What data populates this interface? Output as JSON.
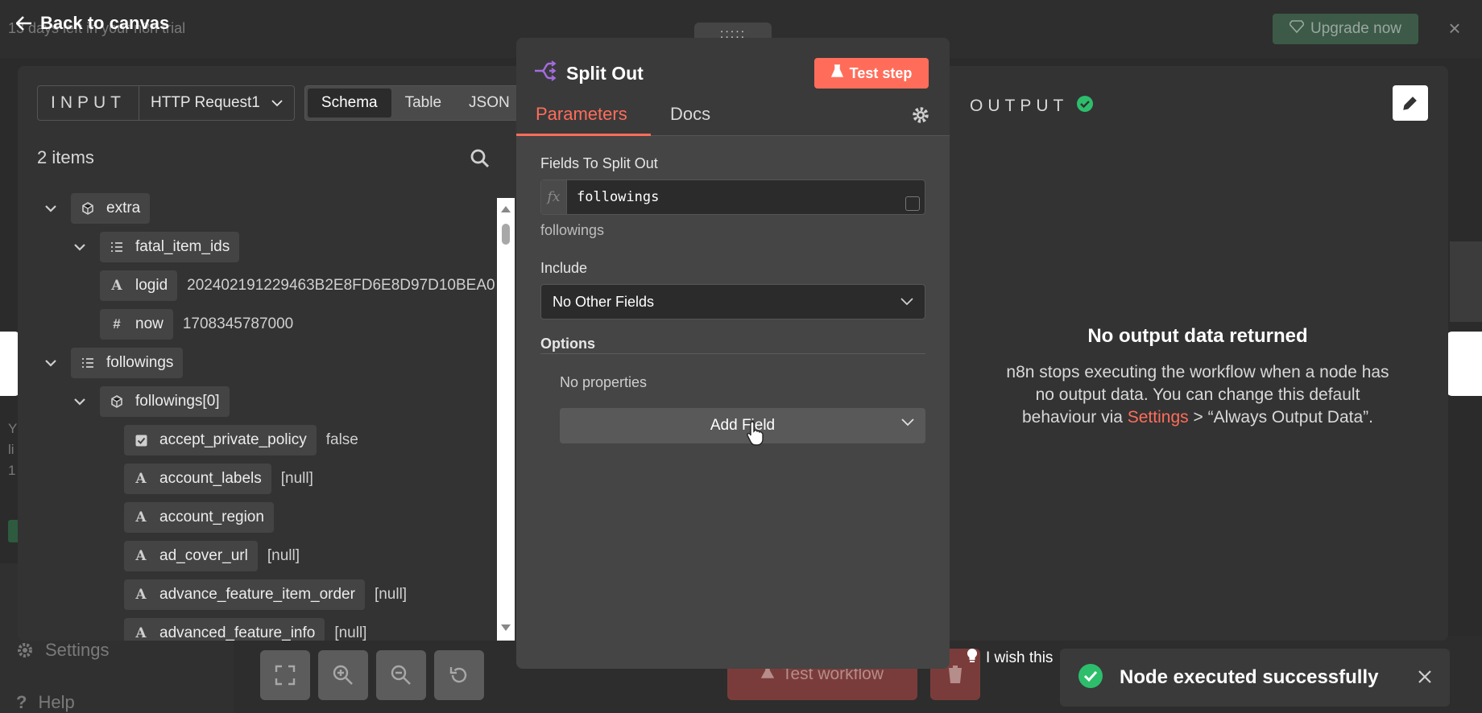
{
  "background": {
    "trial_text": "13 days left in your n8n trial",
    "upgrade_label": "Upgrade now",
    "sidebar_settings": "Settings",
    "sidebar_help": "Help",
    "test_workflow_label": "Test workflow",
    "wish_text": "I wish this"
  },
  "ndv": {
    "back_label": "Back to canvas",
    "input": {
      "label": "INPUT",
      "node_name": "HTTP Request1",
      "modes": [
        "Schema",
        "Table",
        "JSON"
      ],
      "active_mode": "Schema",
      "items_count": "2 items",
      "tree": [
        {
          "key": "extra",
          "type": "object",
          "value": "",
          "depth": 0,
          "expanded": true
        },
        {
          "key": "fatal_item_ids",
          "type": "array",
          "value": "",
          "depth": 1,
          "expanded": true
        },
        {
          "key": "logid",
          "type": "string",
          "value": "202402191229463B2E8FD6E8D97D10BEA0",
          "depth": 1
        },
        {
          "key": "now",
          "type": "number",
          "value": "1708345787000",
          "depth": 1
        },
        {
          "key": "followings",
          "type": "array",
          "value": "",
          "depth": 0,
          "expanded": true
        },
        {
          "key": "followings[0]",
          "type": "object",
          "value": "",
          "depth": 1,
          "expanded": true
        },
        {
          "key": "accept_private_policy",
          "type": "boolean",
          "value": "false",
          "depth": 2
        },
        {
          "key": "account_labels",
          "type": "string",
          "value": "[null]",
          "depth": 2
        },
        {
          "key": "account_region",
          "type": "string",
          "value": "",
          "depth": 2
        },
        {
          "key": "ad_cover_url",
          "type": "string",
          "value": "[null]",
          "depth": 2
        },
        {
          "key": "advance_feature_item_order",
          "type": "string",
          "value": "[null]",
          "depth": 2
        },
        {
          "key": "advanced_feature_info",
          "type": "string",
          "value": "[null]",
          "depth": 2
        }
      ]
    },
    "node": {
      "title": "Split Out",
      "test_step_label": "Test step",
      "tabs": [
        "Parameters",
        "Docs"
      ],
      "active_tab": "Parameters",
      "fields_label": "Fields To Split Out",
      "fields_value": "followings",
      "fields_hint": "followings",
      "include_label": "Include",
      "include_value": "No Other Fields",
      "options_label": "Options",
      "no_properties": "No properties",
      "add_field_label": "Add Field"
    },
    "output": {
      "label": "OUTPUT",
      "empty_title": "No output data returned",
      "empty_text_before": "n8n stops executing the workflow when a node has no output data. You can change this default behaviour via ",
      "empty_link": "Settings",
      "empty_text_after": " > “Always Output Data”."
    }
  },
  "toast": {
    "message": "Node executed successfully"
  },
  "colors": {
    "accent": "#ff6d5a",
    "success": "#2dbe6c",
    "node_icon": "#a46ce0"
  }
}
